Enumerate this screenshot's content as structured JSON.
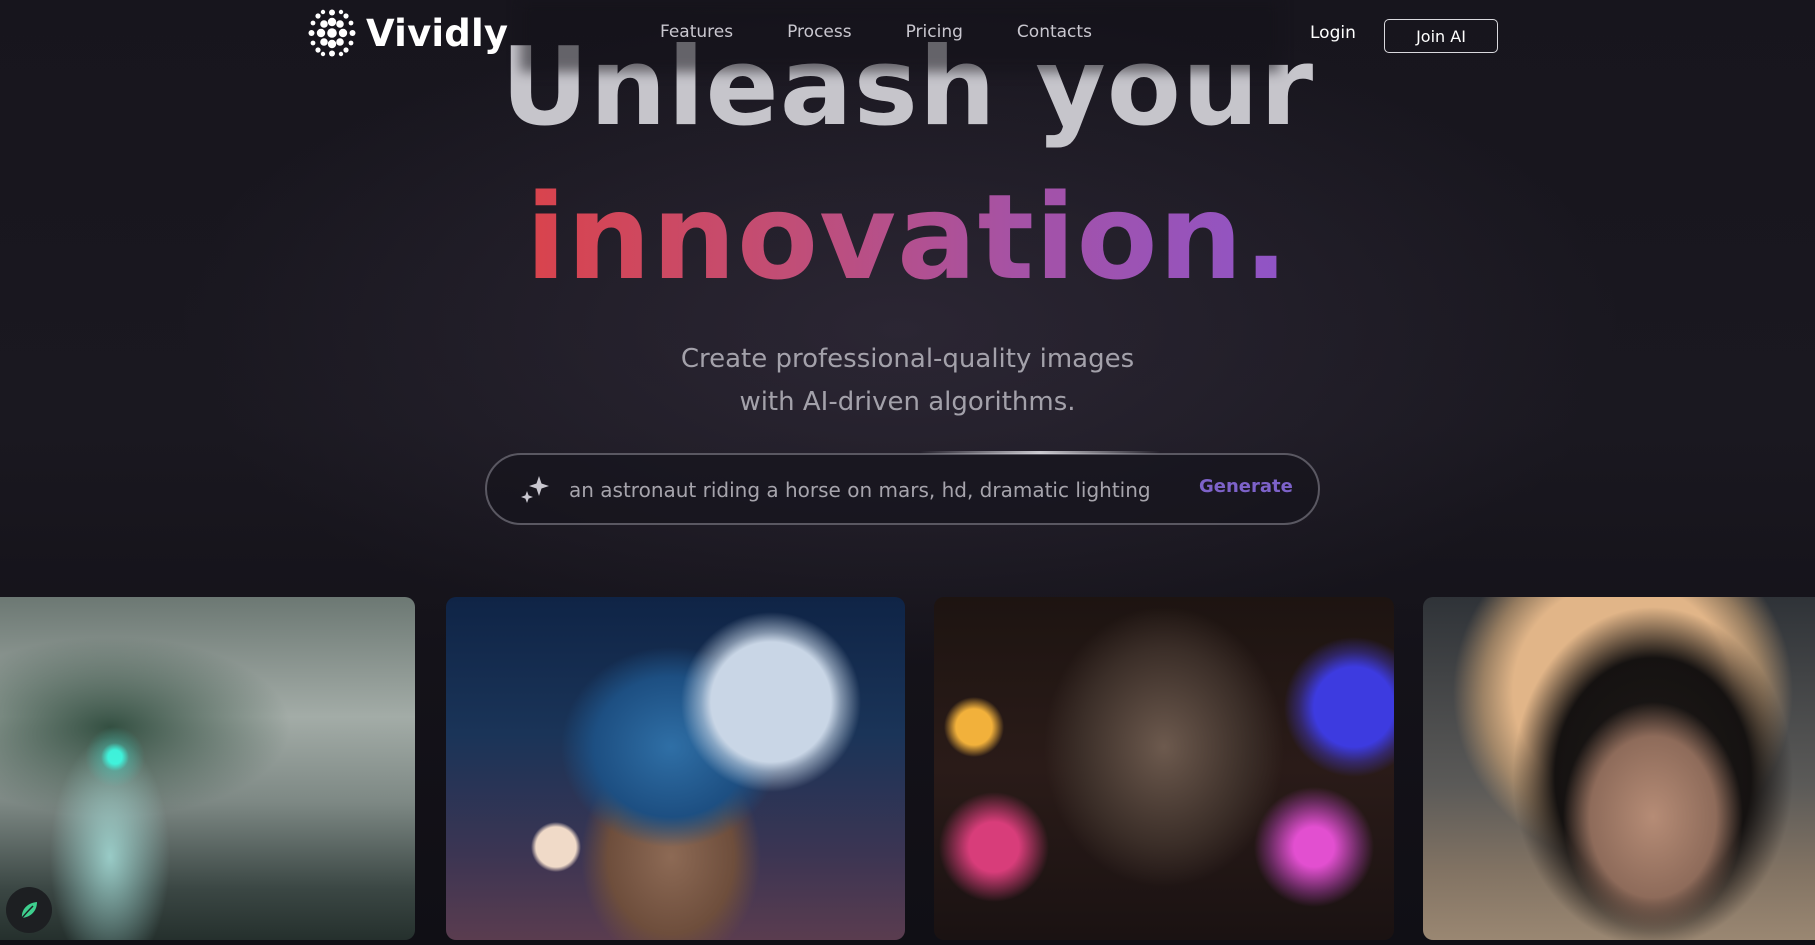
{
  "header": {
    "brand": "Vividly",
    "nav": [
      {
        "label": "Features"
      },
      {
        "label": "Process"
      },
      {
        "label": "Pricing"
      },
      {
        "label": "Contacts"
      }
    ],
    "login_label": "Login",
    "join_label": "Join AI"
  },
  "hero": {
    "line1": "Unleash your",
    "line2": "innovation.",
    "subtitle_line1": "Create professional-quality images",
    "subtitle_line2": "with AI-driven algorithms."
  },
  "prompt": {
    "value": "an astronaut riding a horse on mars, hd, dramatic lighting",
    "generate_label": "Generate"
  },
  "colors": {
    "background": "#13111a",
    "accent": "#7d62c9",
    "gradient_start": "#d9434c",
    "gradient_end": "#8f54c7"
  },
  "icons": {
    "logo": "dotted-sphere-icon",
    "prompt": "sparkle-icon",
    "fab": "leaf-icon"
  },
  "gallery": [
    {
      "name": "dragon-artwork"
    },
    {
      "name": "fantasy-house-artwork"
    },
    {
      "name": "cat-artwork"
    },
    {
      "name": "woman-portrait-artwork"
    }
  ]
}
